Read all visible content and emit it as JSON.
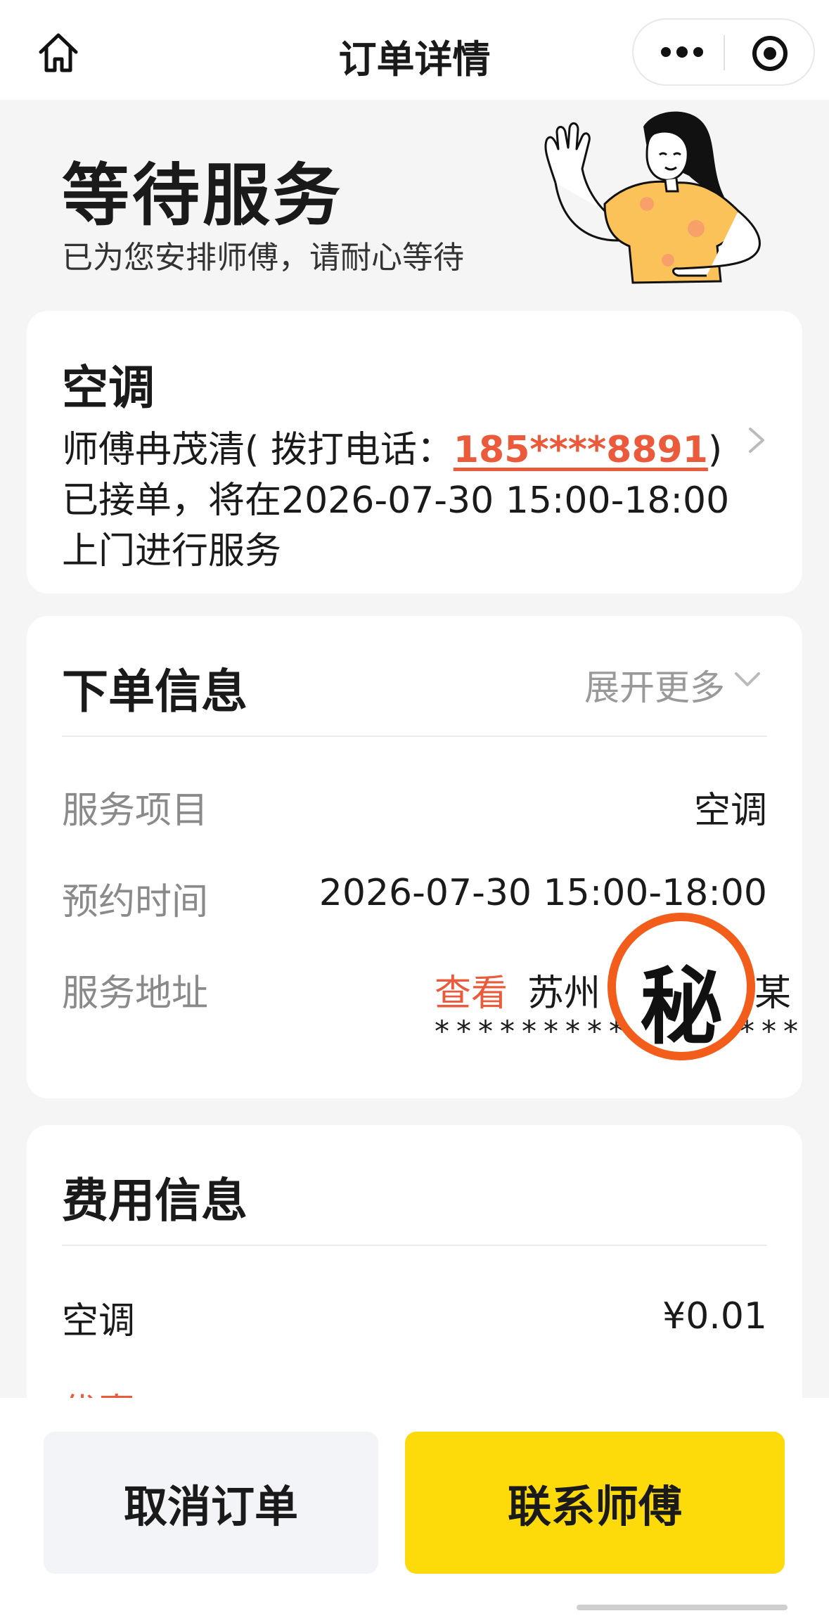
{
  "nav": {
    "title": "订单详情"
  },
  "status": {
    "title": "等待服务",
    "subtitle": "已为您安排师傅，请耐心等待"
  },
  "service_card": {
    "title": "空调",
    "prefix": "师傅冉茂清( 拨打电话：",
    "phone": "185****8891",
    "suffix": ")已接单，将在2026-07-30 15:00-18:00上门进行服务"
  },
  "order_info": {
    "title": "下单信息",
    "expand_label": "展开更多",
    "rows": [
      {
        "label": "服务项目",
        "value": "空调"
      },
      {
        "label": "预约时间",
        "value": "2026-07-30 15:00-18:00"
      },
      {
        "label": "服务地址",
        "view_label": "查看",
        "city": "苏州",
        "tail": "某",
        "masked": "*****************"
      }
    ],
    "secret_badge": "秘"
  },
  "fee_info": {
    "title": "费用信息",
    "items": [
      {
        "label": "空调",
        "value": "¥0.01"
      }
    ],
    "discount_label": "优惠"
  },
  "actions": {
    "cancel": "取消订单",
    "contact": "联系师傅"
  },
  "colors": {
    "accent": "#ea5a3b",
    "primary_button": "#fddb0a",
    "secret_ring": "#f25d1c"
  }
}
